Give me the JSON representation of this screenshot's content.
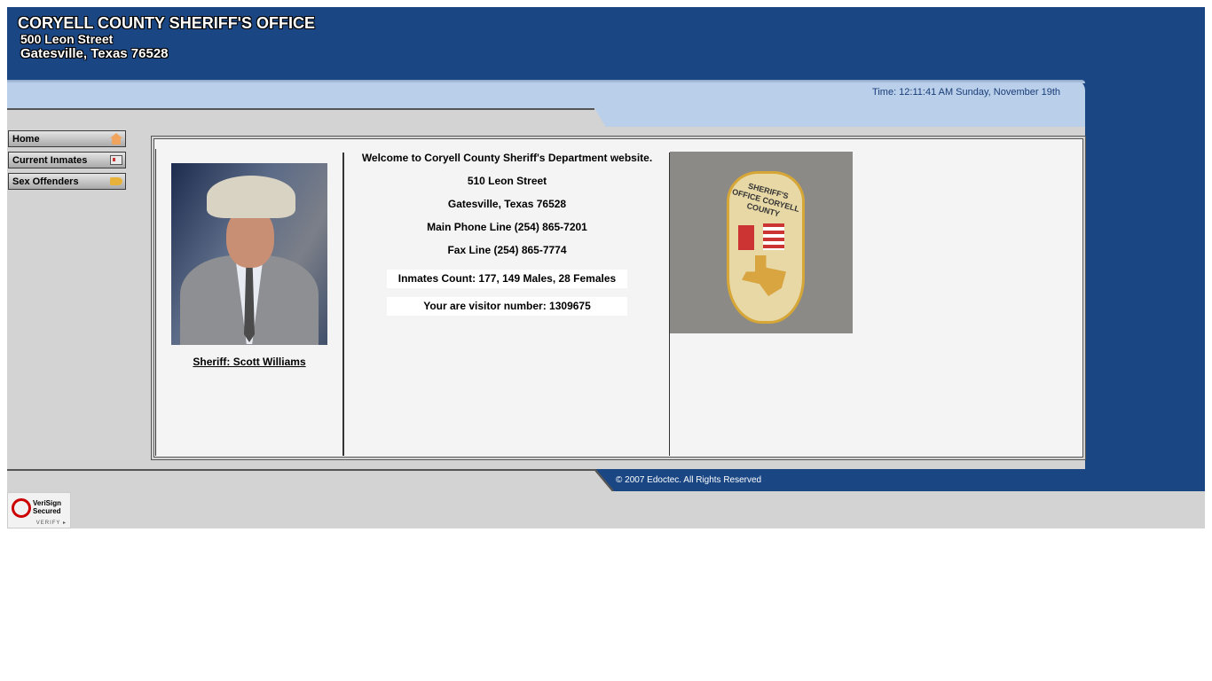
{
  "header": {
    "title": "CORYELL COUNTY SHERIFF'S OFFICE",
    "address_line1": "500 Leon Street",
    "address_line2": "Gatesville, Texas 76528"
  },
  "time_text": "Time: 12:11:41 AM Sunday, November 19th",
  "nav": [
    {
      "label": "Home",
      "icon": "home-icon"
    },
    {
      "label": "Current Inmates",
      "icon": "id-card-icon"
    },
    {
      "label": "Sex Offenders",
      "icon": "pointing-hand-icon"
    }
  ],
  "sheriff": {
    "name_link": "Sheriff: Scott Williams"
  },
  "welcome": {
    "line1": "Welcome to Coryell County Sheriff's Department website.",
    "street": "510 Leon Street",
    "city": "Gatesville, Texas 76528",
    "phone": "Main Phone Line (254) 865-7201",
    "fax": "Fax Line (254) 865-7774",
    "inmates": "Inmates Count: 177, 149 Males, 28 Females",
    "visitor": "Your are visitor number: 1309675"
  },
  "badge": {
    "text": "SHERIFF'S OFFICE CORYELL COUNTY"
  },
  "footer": {
    "copyright": "© 2007 Edoctec. All Rights Reserved"
  },
  "verisign": {
    "line1": "VeriSign",
    "line2": "Secured",
    "verify": "VERIFY ▸"
  },
  "colors": {
    "header_blue": "#1a4784",
    "band_blue": "#b9cfea",
    "grey": "#d3d3d3"
  }
}
